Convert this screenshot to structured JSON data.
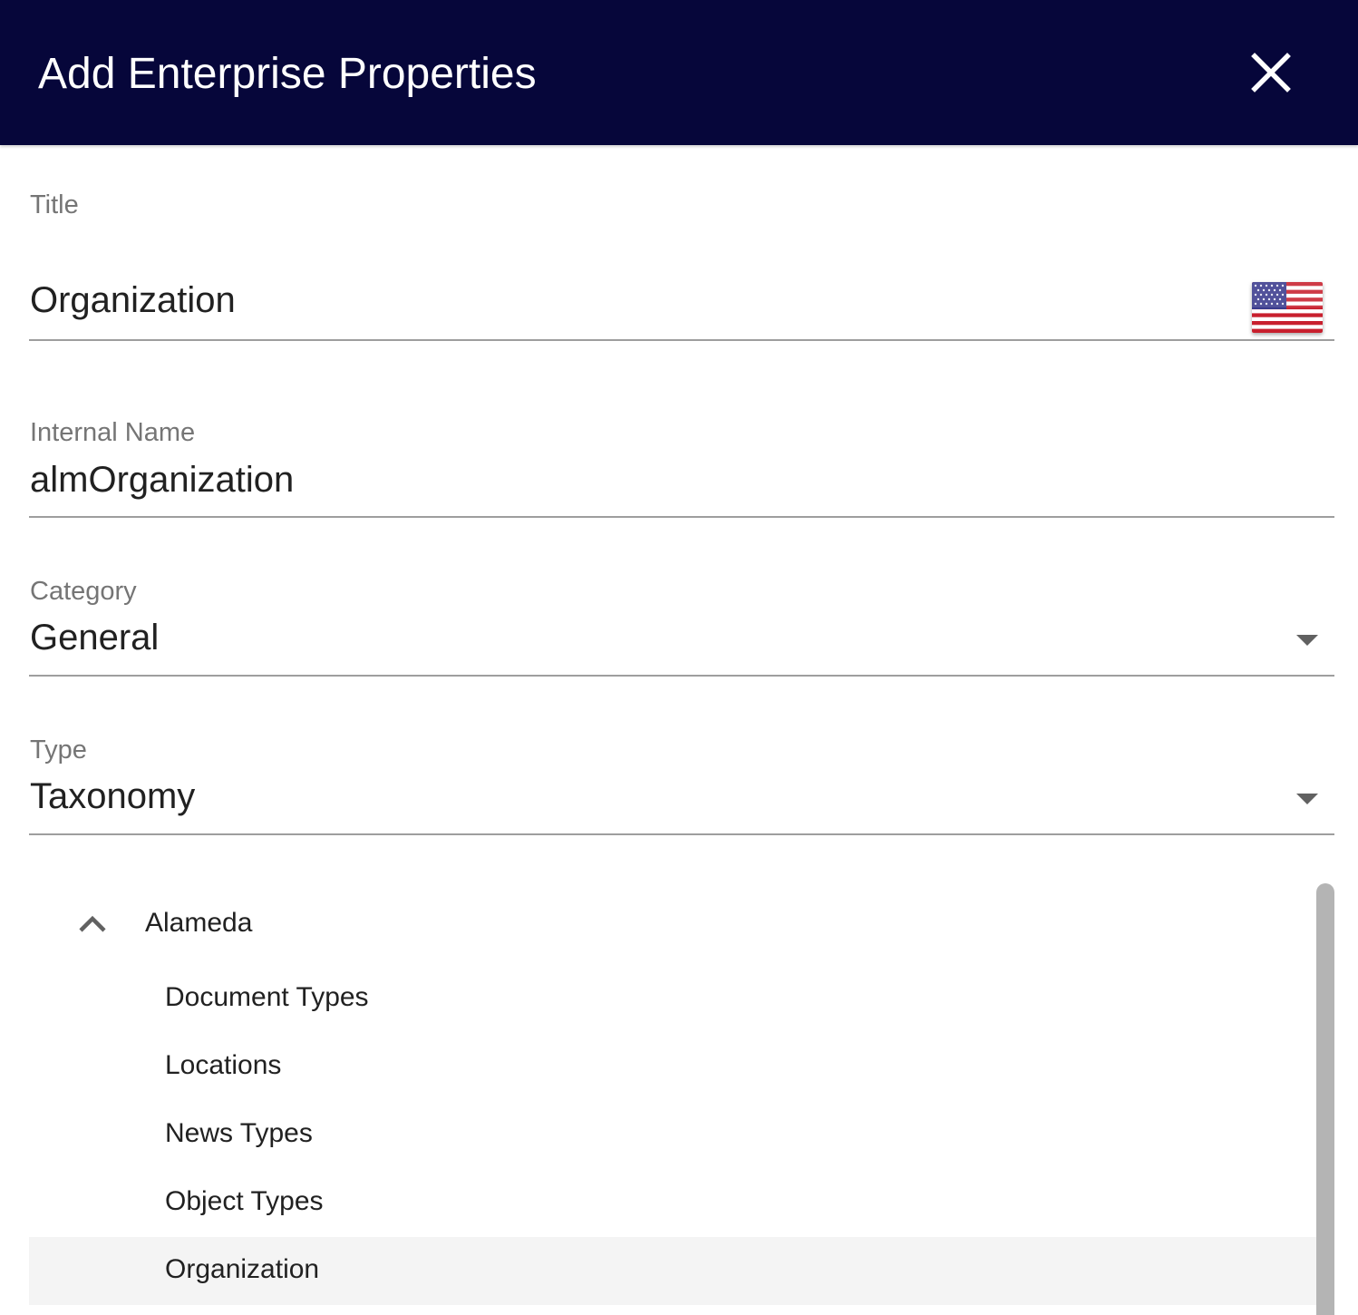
{
  "dialog": {
    "title": "Add Enterprise Properties",
    "close_icon": "close-icon"
  },
  "fields": {
    "title": {
      "label": "Title",
      "value": "Organization",
      "language_flag": "us-flag-icon"
    },
    "internal_name": {
      "label": "Internal Name",
      "value": "almOrganization"
    },
    "category": {
      "label": "Category",
      "value": "General",
      "icon": "dropdown-arrow-icon"
    },
    "type": {
      "label": "Type",
      "value": "Taxonomy",
      "icon": "dropdown-arrow-icon"
    }
  },
  "taxonomy_tree": {
    "root": {
      "label": "Alameda",
      "expanded": true,
      "icon": "chevron-up-icon"
    },
    "children": [
      {
        "label": "Document Types",
        "selected": false
      },
      {
        "label": "Locations",
        "selected": false
      },
      {
        "label": "News Types",
        "selected": false
      },
      {
        "label": "Object Types",
        "selected": false
      },
      {
        "label": "Organization",
        "selected": true
      }
    ]
  },
  "colors": {
    "header_background": "#06063a",
    "header_text": "#ffffff",
    "label_text": "#757575",
    "value_text": "#212121",
    "selected_row": "#f4f4f4"
  }
}
